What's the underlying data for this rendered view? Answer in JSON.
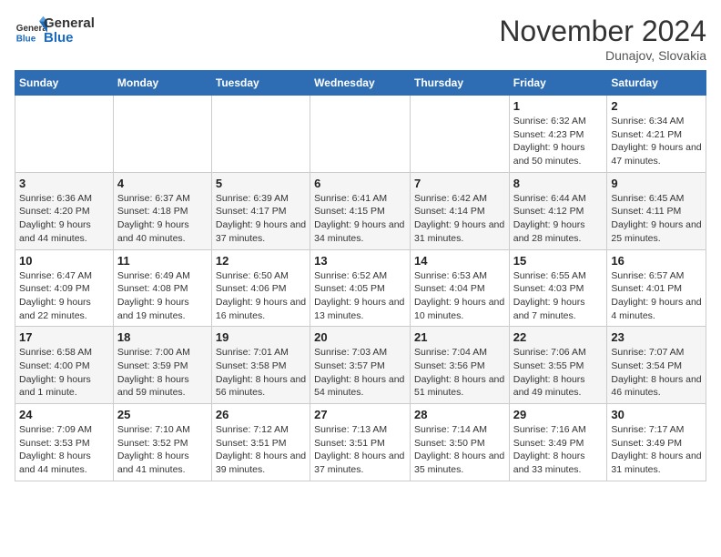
{
  "header": {
    "logo_general": "General",
    "logo_blue": "Blue",
    "month_title": "November 2024",
    "location": "Dunajov, Slovakia"
  },
  "days_of_week": [
    "Sunday",
    "Monday",
    "Tuesday",
    "Wednesday",
    "Thursday",
    "Friday",
    "Saturday"
  ],
  "weeks": [
    [
      null,
      null,
      null,
      null,
      null,
      {
        "day": "1",
        "sunrise": "6:32 AM",
        "sunset": "4:23 PM",
        "daylight": "9 hours and 50 minutes."
      },
      {
        "day": "2",
        "sunrise": "6:34 AM",
        "sunset": "4:21 PM",
        "daylight": "9 hours and 47 minutes."
      }
    ],
    [
      {
        "day": "3",
        "sunrise": "6:36 AM",
        "sunset": "4:20 PM",
        "daylight": "9 hours and 44 minutes."
      },
      {
        "day": "4",
        "sunrise": "6:37 AM",
        "sunset": "4:18 PM",
        "daylight": "9 hours and 40 minutes."
      },
      {
        "day": "5",
        "sunrise": "6:39 AM",
        "sunset": "4:17 PM",
        "daylight": "9 hours and 37 minutes."
      },
      {
        "day": "6",
        "sunrise": "6:41 AM",
        "sunset": "4:15 PM",
        "daylight": "9 hours and 34 minutes."
      },
      {
        "day": "7",
        "sunrise": "6:42 AM",
        "sunset": "4:14 PM",
        "daylight": "9 hours and 31 minutes."
      },
      {
        "day": "8",
        "sunrise": "6:44 AM",
        "sunset": "4:12 PM",
        "daylight": "9 hours and 28 minutes."
      },
      {
        "day": "9",
        "sunrise": "6:45 AM",
        "sunset": "4:11 PM",
        "daylight": "9 hours and 25 minutes."
      }
    ],
    [
      {
        "day": "10",
        "sunrise": "6:47 AM",
        "sunset": "4:09 PM",
        "daylight": "9 hours and 22 minutes."
      },
      {
        "day": "11",
        "sunrise": "6:49 AM",
        "sunset": "4:08 PM",
        "daylight": "9 hours and 19 minutes."
      },
      {
        "day": "12",
        "sunrise": "6:50 AM",
        "sunset": "4:06 PM",
        "daylight": "9 hours and 16 minutes."
      },
      {
        "day": "13",
        "sunrise": "6:52 AM",
        "sunset": "4:05 PM",
        "daylight": "9 hours and 13 minutes."
      },
      {
        "day": "14",
        "sunrise": "6:53 AM",
        "sunset": "4:04 PM",
        "daylight": "9 hours and 10 minutes."
      },
      {
        "day": "15",
        "sunrise": "6:55 AM",
        "sunset": "4:03 PM",
        "daylight": "9 hours and 7 minutes."
      },
      {
        "day": "16",
        "sunrise": "6:57 AM",
        "sunset": "4:01 PM",
        "daylight": "9 hours and 4 minutes."
      }
    ],
    [
      {
        "day": "17",
        "sunrise": "6:58 AM",
        "sunset": "4:00 PM",
        "daylight": "9 hours and 1 minute."
      },
      {
        "day": "18",
        "sunrise": "7:00 AM",
        "sunset": "3:59 PM",
        "daylight": "8 hours and 59 minutes."
      },
      {
        "day": "19",
        "sunrise": "7:01 AM",
        "sunset": "3:58 PM",
        "daylight": "8 hours and 56 minutes."
      },
      {
        "day": "20",
        "sunrise": "7:03 AM",
        "sunset": "3:57 PM",
        "daylight": "8 hours and 54 minutes."
      },
      {
        "day": "21",
        "sunrise": "7:04 AM",
        "sunset": "3:56 PM",
        "daylight": "8 hours and 51 minutes."
      },
      {
        "day": "22",
        "sunrise": "7:06 AM",
        "sunset": "3:55 PM",
        "daylight": "8 hours and 49 minutes."
      },
      {
        "day": "23",
        "sunrise": "7:07 AM",
        "sunset": "3:54 PM",
        "daylight": "8 hours and 46 minutes."
      }
    ],
    [
      {
        "day": "24",
        "sunrise": "7:09 AM",
        "sunset": "3:53 PM",
        "daylight": "8 hours and 44 minutes."
      },
      {
        "day": "25",
        "sunrise": "7:10 AM",
        "sunset": "3:52 PM",
        "daylight": "8 hours and 41 minutes."
      },
      {
        "day": "26",
        "sunrise": "7:12 AM",
        "sunset": "3:51 PM",
        "daylight": "8 hours and 39 minutes."
      },
      {
        "day": "27",
        "sunrise": "7:13 AM",
        "sunset": "3:51 PM",
        "daylight": "8 hours and 37 minutes."
      },
      {
        "day": "28",
        "sunrise": "7:14 AM",
        "sunset": "3:50 PM",
        "daylight": "8 hours and 35 minutes."
      },
      {
        "day": "29",
        "sunrise": "7:16 AM",
        "sunset": "3:49 PM",
        "daylight": "8 hours and 33 minutes."
      },
      {
        "day": "30",
        "sunrise": "7:17 AM",
        "sunset": "3:49 PM",
        "daylight": "8 hours and 31 minutes."
      }
    ]
  ]
}
